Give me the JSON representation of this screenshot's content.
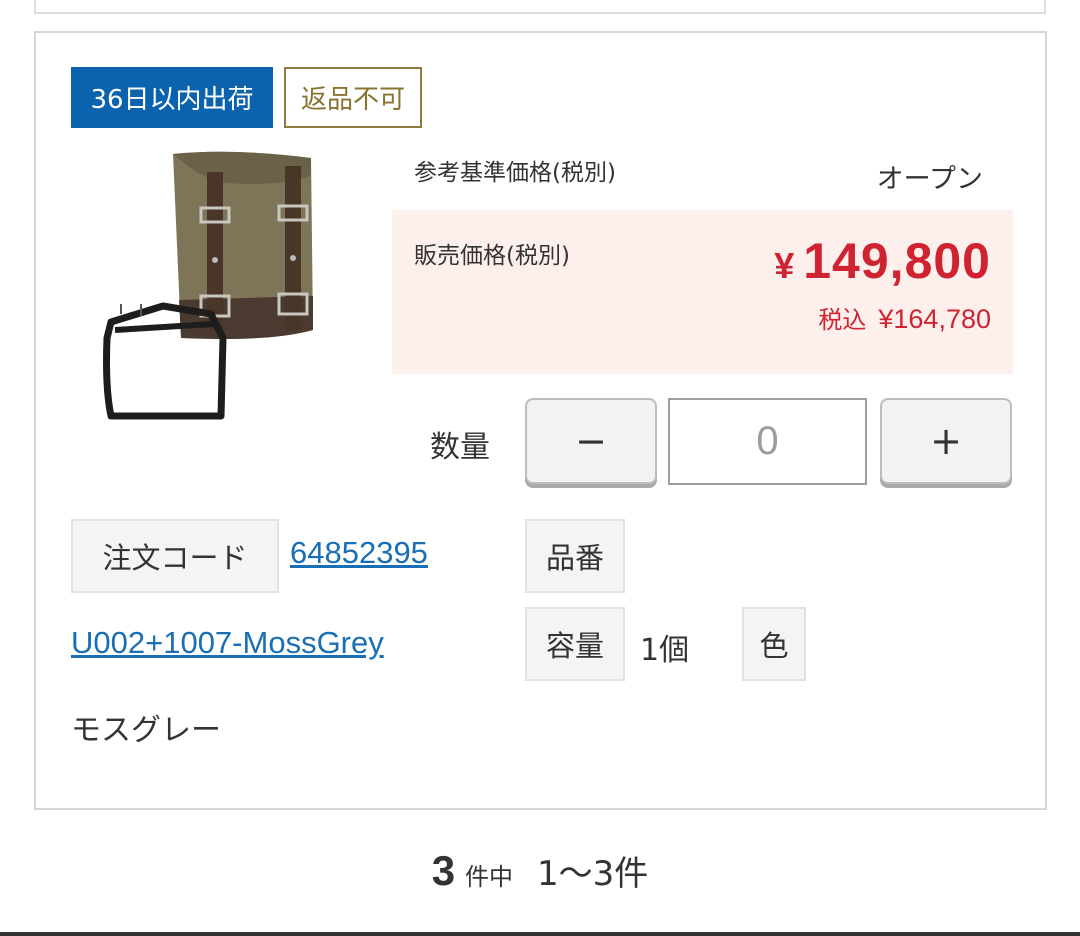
{
  "badges": {
    "shipping": "36日以内出荷",
    "no_return": "返品不可"
  },
  "product": {
    "image_icon": "saddle-bag-with-frame-image",
    "reference_price_label": "参考基準価格(税別)",
    "reference_price_value": "オープン",
    "sale_price_label": "販売価格(税別)",
    "sale_price_currency": "¥",
    "sale_price_amount": "149,800",
    "tax_included_label": "税込",
    "tax_included_price": "¥164,780"
  },
  "quantity": {
    "label": "数量",
    "minus_label": "−",
    "plus_label": "+",
    "value": "0"
  },
  "specs": {
    "order_code_label": "注文コード",
    "order_code_value": "64852395",
    "part_number_label": "品番",
    "part_number_value": "U002+1007-MossGrey",
    "capacity_label": "容量",
    "capacity_value": "1個",
    "color_label": "色",
    "color_value": "モスグレー"
  },
  "pagination": {
    "total": "3",
    "middle_text": "件中",
    "range_text": "1〜3件"
  },
  "colors": {
    "badge_blue": "#0b63ad",
    "badge_gold": "#8a7330",
    "price_red": "#cf2331",
    "price_bg": "#fdf0ec",
    "link_blue": "#1a6fb4"
  }
}
